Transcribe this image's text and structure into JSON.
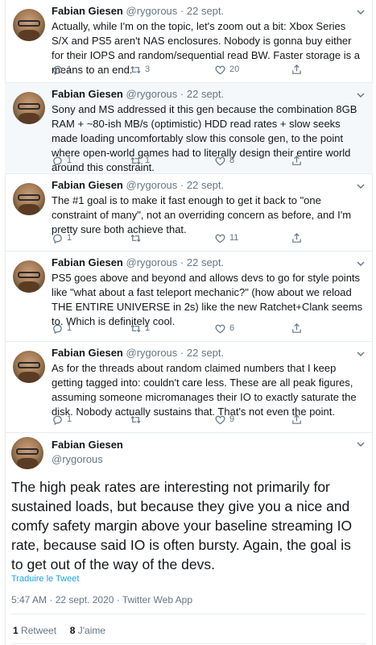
{
  "thread": [
    {
      "name": "Fabian Giesen",
      "handle": "@rygorous",
      "date": "22 sept.",
      "text": "Actually, while I'm on the topic, let's zoom out a bit: Xbox Series S/X and PS5 aren't NAS enclosures. Nobody is gonna buy either for their IOPS and random/sequential read BW. Faster storage is a means to an end.",
      "replies": "1",
      "retweets": "3",
      "likes": "20"
    },
    {
      "name": "Fabian Giesen",
      "handle": "@rygorous",
      "date": "22 sept.",
      "text": "Sony and MS addressed it this gen because the combination 8GB RAM + ~80-ish MB/s (optimistic) HDD read rates + slow seeks made loading uncomfortably slow this console gen, to the point where open-world games had to literally design their entire world around this constraint.",
      "replies": "1",
      "retweets": "1",
      "likes": "8"
    },
    {
      "name": "Fabian Giesen",
      "handle": "@rygorous",
      "date": "22 sept.",
      "text": "The #1 goal is to make it fast enough to get it back to \"one constraint of many\", not an overriding concern as before, and I'm pretty sure both achieve that.",
      "replies": "1",
      "retweets": "",
      "likes": "11"
    },
    {
      "name": "Fabian Giesen",
      "handle": "@rygorous",
      "date": "22 sept.",
      "text": "PS5 goes above and beyond and allows devs to go for style points like \"what about a fast teleport mechanic?\" (how about we reload THE ENTIRE UNIVERSE in 2s) like the new Ratchet+Clank seems to. Which is definitely cool.",
      "replies": "1",
      "retweets": "1",
      "likes": "6"
    },
    {
      "name": "Fabian Giesen",
      "handle": "@rygorous",
      "date": "22 sept.",
      "text": "As for the threads about random claimed numbers that I keep getting tagged into: couldn't care less. These are all peak figures, assuming someone micromanages their IO to exactly saturate the disk. Nobody actually sustains that. That's not even the point.",
      "replies": "1",
      "retweets": "",
      "likes": "9"
    }
  ],
  "separator": "·",
  "main": {
    "name": "Fabian Giesen",
    "handle": "@rygorous",
    "text": "The high peak rates are interesting not primarily for sustained loads, but because they give you a nice and comfy safety margin above your baseline streaming IO rate, because said IO is often bursty. Again, the goal is to get out of the way of the devs.",
    "translate": "Traduire le Tweet",
    "meta": "5:47 AM · 22 sept. 2020 · Twitter Web App",
    "retweets_count": "1",
    "retweets_label": "Retweet",
    "likes_count": "8",
    "likes_label": "J'aime"
  },
  "colors": {
    "accent": "#1da1f2",
    "muted": "#657786",
    "highlight_bg": "#f5f8fa"
  }
}
